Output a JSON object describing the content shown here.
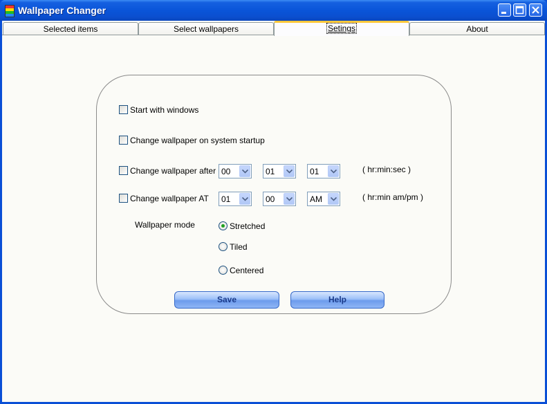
{
  "window": {
    "title": "Wallpaper Changer"
  },
  "tabs": [
    {
      "label": "Selected items"
    },
    {
      "label": "Select wallpapers"
    },
    {
      "label": "Setings",
      "active": true
    },
    {
      "label": "About"
    }
  ],
  "settings": {
    "start_with_windows": {
      "label": "Start with windows",
      "checked": false
    },
    "change_on_startup": {
      "label": "Change wallpaper on system startup",
      "checked": false
    },
    "change_after": {
      "label": "Change wallpaper after",
      "checked": false,
      "hours": "00",
      "minutes": "01",
      "seconds": "01",
      "hint": "( hr:min:sec )"
    },
    "change_at": {
      "label": "Change wallpaper AT",
      "checked": false,
      "hours": "01",
      "minutes": "00",
      "ampm": "AM",
      "hint": "( hr:min am/pm )"
    },
    "mode": {
      "label": "Wallpaper mode",
      "options": [
        {
          "label": "Stretched",
          "selected": true
        },
        {
          "label": "Tiled",
          "selected": false
        },
        {
          "label": "Centered",
          "selected": false
        }
      ]
    }
  },
  "buttons": {
    "save": "Save",
    "help": "Help"
  },
  "colors": {
    "titlebar": "#0a55d9",
    "tab_active_accent": "#ffc83c",
    "radio_dot": "#21a121"
  }
}
